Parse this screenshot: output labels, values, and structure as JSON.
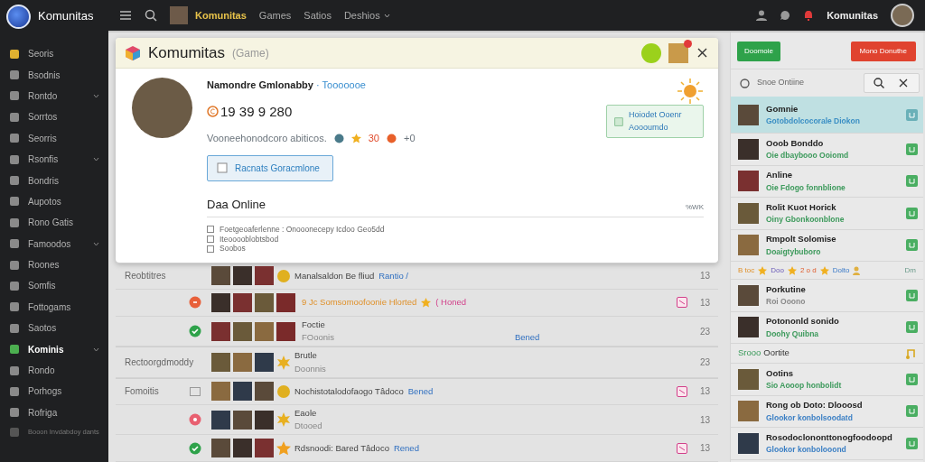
{
  "sidebar": {
    "brand": "Komunitas",
    "items": [
      {
        "label": "Seoris",
        "selected": false,
        "expandable": false
      },
      {
        "label": "Bsodnis",
        "selected": false,
        "expandable": false
      },
      {
        "label": "Rontdo",
        "selected": false,
        "expandable": true
      },
      {
        "label": "Sorrtos",
        "selected": false,
        "expandable": false
      },
      {
        "label": "Seorris",
        "selected": false,
        "expandable": false
      },
      {
        "label": "Rsonfis",
        "selected": false,
        "expandable": true
      },
      {
        "label": "Bondris",
        "selected": false,
        "expandable": false
      },
      {
        "label": "Aupotos",
        "selected": false,
        "expandable": false
      },
      {
        "label": "Rono Gatis",
        "selected": false,
        "expandable": false
      },
      {
        "label": "Famoodos",
        "selected": false,
        "expandable": true
      },
      {
        "label": "Roones",
        "selected": false,
        "expandable": false
      },
      {
        "label": "Somfis",
        "selected": false,
        "expandable": false
      },
      {
        "label": "Fottogams",
        "selected": false,
        "expandable": false
      },
      {
        "label": "Saotos",
        "selected": false,
        "expandable": false
      },
      {
        "label": "Kominis",
        "selected": true,
        "expandable": true
      },
      {
        "label": "Rondo",
        "selected": false,
        "expandable": false
      },
      {
        "label": "Porhogs",
        "selected": false,
        "expandable": false
      },
      {
        "label": "Rofriga",
        "selected": false,
        "expandable": false
      }
    ],
    "footer": "Booon Invdabdoy dants"
  },
  "topbar": {
    "brand": "Komunitas",
    "links": [
      {
        "label": "Games",
        "dropdown": false
      },
      {
        "label": "Satios",
        "dropdown": false
      },
      {
        "label": "Deshios",
        "dropdown": true
      }
    ],
    "user": "Komunitas"
  },
  "modal": {
    "title": "Komumitas",
    "subtitle": "(Game)",
    "profile": {
      "name": "Namondre Gmlonabby",
      "tag": "· Tooooooe",
      "number": "19  39  9 280",
      "meta": "Vooneehonodcoro abiticos.",
      "meta_count": "30",
      "meta_extra": "+0"
    },
    "action": "Racnats Goracmlone",
    "promo": "Hoiodet Ooenr Aoooumdo",
    "section": {
      "title": "Daa Online",
      "aside": "%WK",
      "lines": [
        "Foetgeoaferlenne : Onooonecepy Icdoo Geo5dd",
        "Iteooooblobtsbod",
        "Soobos"
      ]
    }
  },
  "list": [
    {
      "label": "Reobtitres",
      "badge": {
        "kind": "coin"
      },
      "title": "Manalsaldon Be fliud",
      "highlight": false,
      "star": false,
      "link": "Rantio /",
      "flag": false,
      "count": "13"
    },
    {
      "status": {
        "kind": "error"
      },
      "badge": {
        "kind": "photo"
      },
      "title": "9 Jc Somsomoofoonie Hlorted",
      "highlight": true,
      "star": true,
      "tag": "( Honed",
      "flag": true,
      "count": "13"
    },
    {
      "status": {
        "kind": "ok"
      },
      "badge": {
        "kind": "photo"
      },
      "title": "Foctie",
      "highlight": false,
      "star": false,
      "subtitle": "FOoonis",
      "link": "Bened",
      "flag": false,
      "count": "23"
    },
    {
      "label": "Rectoorgdmoddy",
      "badge": {
        "kind": "spark"
      },
      "title": "Brutle",
      "highlight": false,
      "star": false,
      "subtitle": "Doonnis",
      "flag": false,
      "count": "23"
    },
    {
      "label": "Fomoitis",
      "status": {
        "kind": "box"
      },
      "badge": {
        "kind": "coin"
      },
      "title": "Nochistotalodofaogo  Tâdoco",
      "highlight": false,
      "star": false,
      "link": "Bened",
      "flag": true,
      "count": "13"
    },
    {
      "status": {
        "kind": "pin"
      },
      "badge": {
        "kind": "spark"
      },
      "title": "Eaole",
      "highlight": false,
      "star": false,
      "subtitle": "Dtooed",
      "flag": false,
      "count": "13"
    },
    {
      "status": {
        "kind": "ok"
      },
      "badge": {
        "kind": "star"
      },
      "title": "Rdsnoodi: Bared  Tâdoco",
      "highlight": false,
      "star": false,
      "link": "Rened",
      "flag": true,
      "count": "13"
    }
  ],
  "panel": {
    "primary": "Doomoie",
    "danger": "Mono Donuthe",
    "search": {
      "placeholder": "Snoe Ontiine"
    },
    "items": [
      {
        "kind": "item",
        "title": "Gomnie",
        "subtitle": "Gotobdolcocorale Diokon",
        "color": "#3b8fc4",
        "selected": true
      },
      {
        "kind": "item",
        "title": "Ooob Bonddo",
        "subtitle": "Oie dbaybooo Ooiomd",
        "color": "#3d9a5c",
        "selected": false
      },
      {
        "kind": "item",
        "title": "Anline",
        "subtitle": "Oie Fdogo fonnblione",
        "color": "#3d9a5c",
        "selected": false
      },
      {
        "kind": "item",
        "title": "Rolit Kuot Horick",
        "subtitle": "Oiny Gbonkoonblone",
        "color": "#3d9a5c",
        "selected": false
      },
      {
        "kind": "item",
        "title": "Rmpolt Solomise",
        "subtitle": "Doaigtybuboro",
        "color": "#3d9a5c",
        "selected": false
      },
      {
        "kind": "tags",
        "tags": [
          "B toc",
          "Doo",
          "2 o d",
          "Dolto"
        ],
        "aside": "Dm",
        "selected": false
      },
      {
        "kind": "item",
        "title": "Porkutine",
        "subtitle": "Roi Ooono",
        "color": "#8a8a8a",
        "selected": false
      },
      {
        "kind": "item",
        "title": "Potononld sonido",
        "subtitle": "Doohy Quibna",
        "color": "#3d9a5c",
        "selected": false
      },
      {
        "kind": "section",
        "title": "Srooo",
        "rest": "Oortite",
        "selected": false
      },
      {
        "kind": "item",
        "title": "Ootins",
        "subtitle": "Sio Aooop honbolidt",
        "color": "#3d9a5c",
        "selected": false
      },
      {
        "kind": "item",
        "title": "Rong ob Doto: Dlooosd",
        "subtitle": "Glookor konbolsoodatd",
        "color": "#3b7fc4",
        "selected": false
      },
      {
        "kind": "item",
        "title": "Rosodoclononttonogfoodoopd",
        "subtitle": "Glookor konbolooond",
        "color": "#3b7fc4",
        "selected": false
      }
    ]
  }
}
